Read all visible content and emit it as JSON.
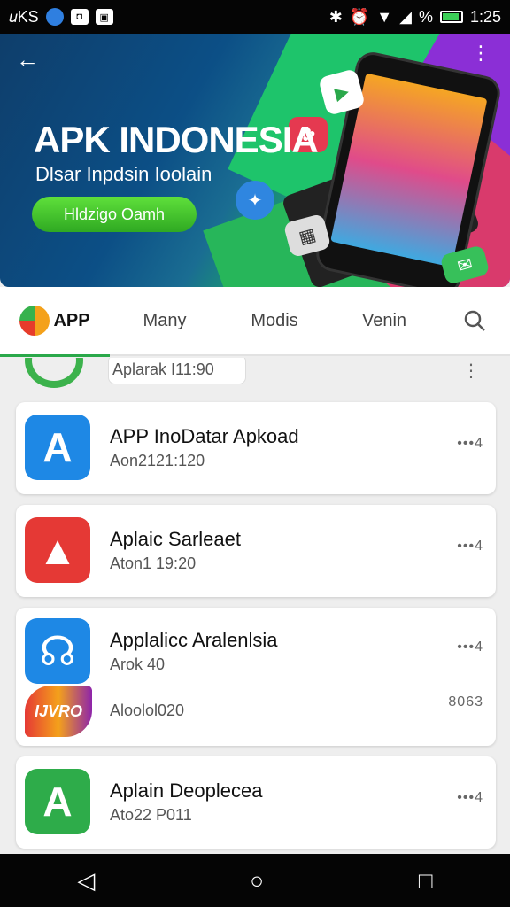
{
  "status": {
    "left_text": "𝑢KS",
    "time": "1:25",
    "battery_label": "%"
  },
  "banner": {
    "title": "APK INDONESIA",
    "subtitle": "Dlsar Inpdsin Ioolain",
    "button_label": "Hldzigo Oamh"
  },
  "tabs": [
    {
      "label": "APP"
    },
    {
      "label": "Many"
    },
    {
      "label": "Modis"
    },
    {
      "label": "Venin"
    }
  ],
  "list": {
    "partial_item": {
      "meta": "Aplarak I11:90"
    },
    "items": [
      {
        "name": "APP InoDatar Apkoad",
        "meta": "Aon2121:120",
        "more": "•••4",
        "color": "#1e88e5"
      },
      {
        "name": "Aplaic Sarleaet",
        "meta": "Aton1 19:20",
        "more": "•••4",
        "color": "#e53935"
      },
      {
        "name": "Applalicc Aralenlsia",
        "meta": "Arok 40",
        "more": "•••4",
        "color": "#1e88e5",
        "sub_meta": "Aloolol020",
        "sub_count": "8063",
        "sub_icon_label": "IJVRO"
      },
      {
        "name": "Aplain Deoplecea",
        "meta": "Ato22 P011",
        "more": "•••4",
        "color": "#2eac4a"
      }
    ]
  }
}
